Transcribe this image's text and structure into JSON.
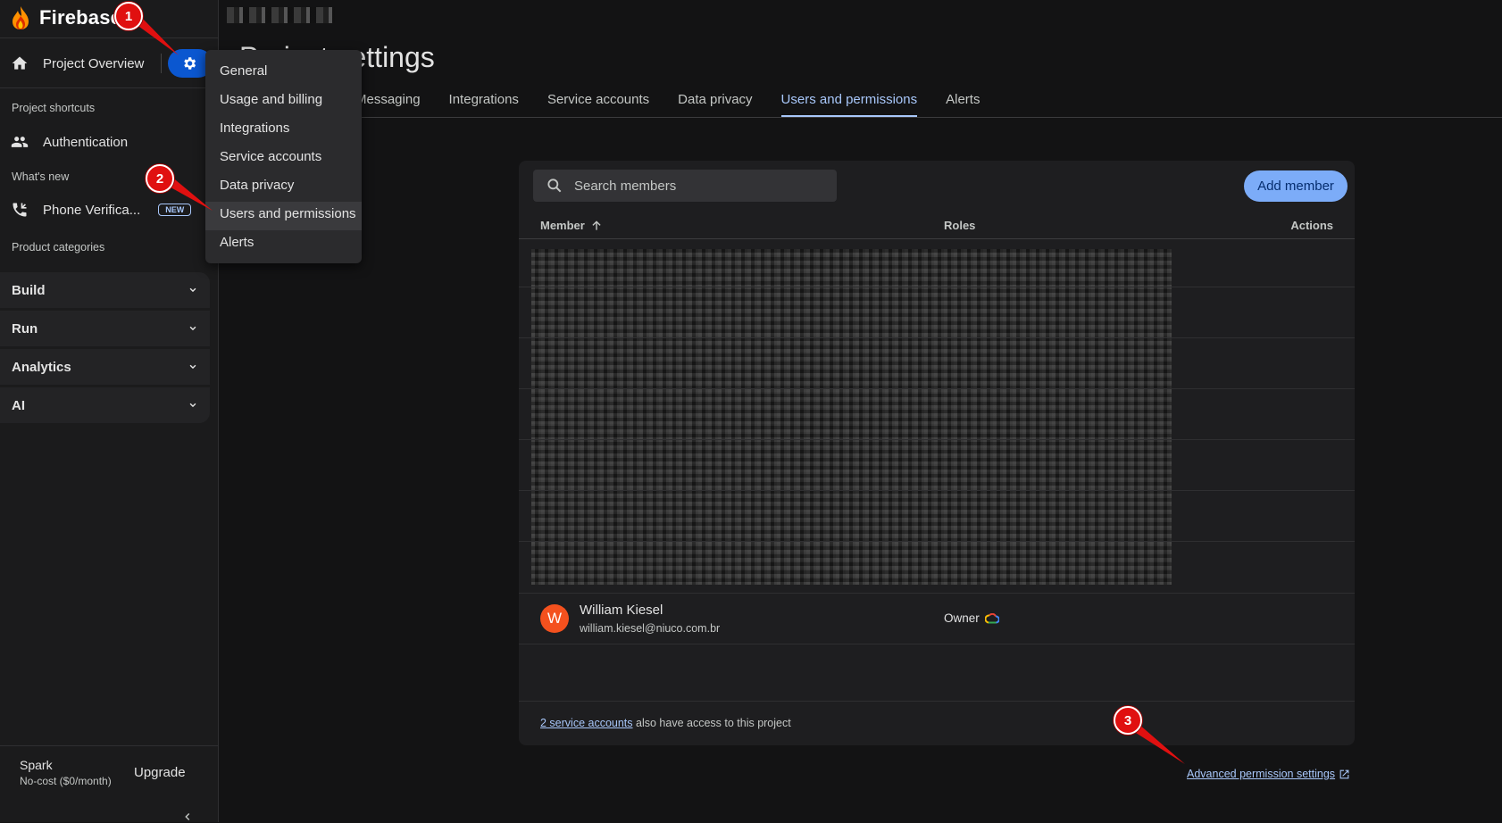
{
  "app": {
    "brand": "Firebase"
  },
  "sidebar": {
    "overview_label": "Project Overview",
    "shortcuts_label": "Project shortcuts",
    "authentication_label": "Authentication",
    "whats_new_label": "What's new",
    "phone_label": "Phone Verifica...",
    "new_badge": "NEW",
    "categories_label": "Product categories",
    "categories": [
      "Build",
      "Run",
      "Analytics",
      "AI"
    ],
    "plan_name": "Spark",
    "plan_sub": "No-cost ($0/month)",
    "upgrade_label": "Upgrade"
  },
  "page": {
    "title": "Project settings",
    "tabs": [
      "Messaging",
      "Integrations",
      "Service accounts",
      "Data privacy",
      "Users and permissions",
      "Alerts"
    ],
    "active_tab": "Users and permissions"
  },
  "settings_menu": {
    "items": [
      "General",
      "Usage and billing",
      "Integrations",
      "Service accounts",
      "Data privacy",
      "Users and permissions",
      "Alerts"
    ],
    "highlighted": "Users and permissions"
  },
  "members": {
    "search_placeholder": "Search members",
    "add_member_label": "Add member",
    "columns": {
      "member": "Member",
      "roles": "Roles",
      "actions": "Actions"
    },
    "rows": [
      {
        "initial": "W",
        "name": "William Kiesel",
        "email": "william.kiesel@niuco.com.br",
        "role": "Owner"
      }
    ],
    "footer_link": "2 service accounts",
    "footer_text": "also have access to this project"
  },
  "advanced_link": "Advanced permission settings",
  "annotations": [
    "1",
    "2",
    "3"
  ],
  "colors": {
    "accent": "#a8c7fa",
    "primary_button": "#7cacf8",
    "gear_button": "#0b57d0",
    "callout": "#e01010",
    "avatar": "#f4511e"
  }
}
